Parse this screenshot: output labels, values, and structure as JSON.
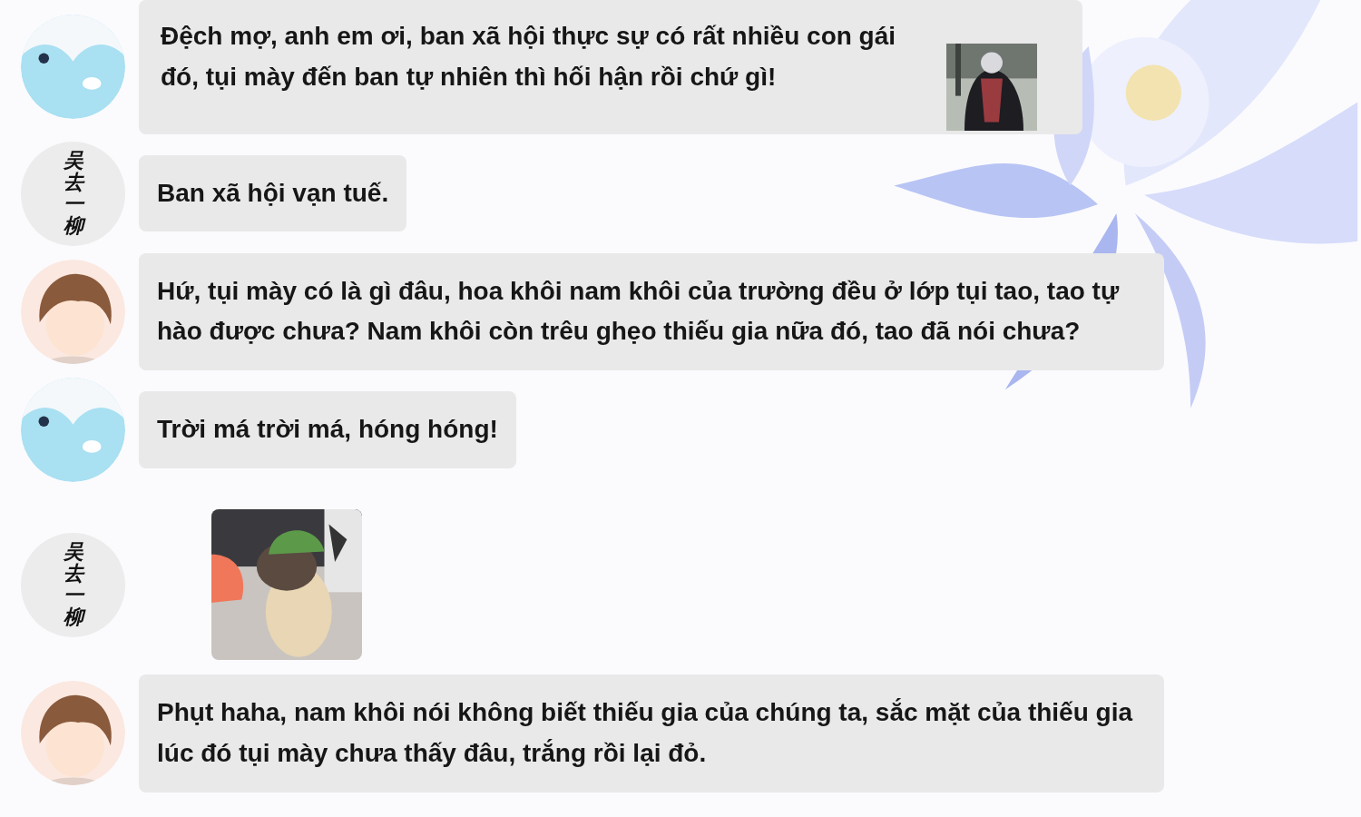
{
  "messages": [
    {
      "avatar": {
        "kind": "bird"
      },
      "kind": "text",
      "text": "Đệch mợ, anh em ơi, ban xã hội thực sự có rất nhiều con gái đó, tụi mày đến ban tự nhiên thì hối hận rồi chứ gì!"
    },
    {
      "avatar": {
        "kind": "name",
        "text": "吴去一柳"
      },
      "kind": "text",
      "text": "Ban xã hội vạn tuế."
    },
    {
      "avatar": {
        "kind": "person"
      },
      "kind": "text",
      "text": "Hứ, tụi mày có là gì đâu, hoa khôi nam khôi của trường đều ở lớp tụi tao, tao tự hào được chưa? Nam khôi còn trêu ghẹo thiếu gia nữa đó, tao đã nói chưa?"
    },
    {
      "avatar": {
        "kind": "bird"
      },
      "kind": "text",
      "text": "Trời má trời má, hóng hóng!"
    },
    {
      "avatar": {
        "kind": "name",
        "text": "吴去一柳"
      }
    },
    {
      "avatar": {
        "kind": "person"
      },
      "kind": "text",
      "text": "Phụt haha, nam khôi nói không biết thiếu gia của chúng ta, sắc mặt của thiếu gia lúc đó tụi mày chưa thấy đâu, trắng rồi lại đỏ."
    }
  ]
}
